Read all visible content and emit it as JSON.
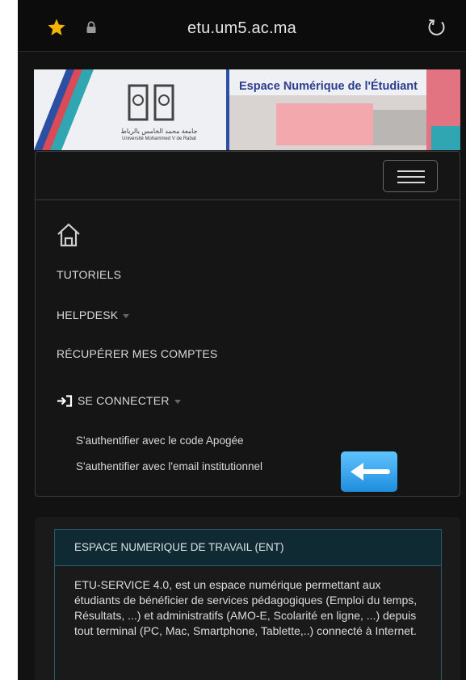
{
  "browser": {
    "url": "etu.um5.ac.ma"
  },
  "banner": {
    "title": "Espace Numérique de l'Étudiant",
    "university_ar": "جامعة محمد الخامس بالرباط",
    "university_fr": "Université Mohammed V de Rabat"
  },
  "nav": {
    "items": [
      {
        "label": "TUTORIELS"
      },
      {
        "label": "HELPDESK"
      },
      {
        "label": "RÉCUPÉRER MES COMPTES"
      },
      {
        "label": "SE CONNECTER"
      }
    ],
    "login_options": [
      {
        "label": "S'authentifier avec le code Apogée"
      },
      {
        "label": "S'authentifier avec l'email institutionnel"
      }
    ]
  },
  "card": {
    "title": "ESPACE NUMERIQUE DE TRAVAIL (ENT)",
    "body": "ETU-SERVICE 4.0, est un espace numérique permettant aux étudiants de bénéficier de services pédagogiques (Emploi du temps, Résultats, ...) et administratifs (AMO-E, Scolarité en ligne, ...) depuis tout terminal (PC, Mac, Smartphone, Tablette,..) connecté à Internet."
  },
  "colors": {
    "background": "#121212",
    "accent": "#2b3d8f",
    "star": "#f5b400",
    "arrow_button": "#1f8ddd"
  },
  "icons": [
    "star-icon",
    "lock-icon",
    "reload-icon",
    "menu-icon",
    "home-icon",
    "login-icon",
    "arrow-left-icon"
  ]
}
